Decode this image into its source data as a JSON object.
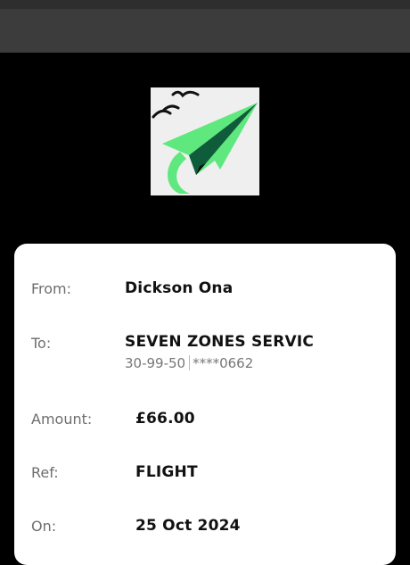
{
  "transfer": {
    "from_label": "From:",
    "from_value": "Dickson Ona",
    "to_label": "To:",
    "to_name": "SEVEN ZONES SERVIC",
    "to_sort_code": "30-99-50",
    "to_account": "****0662",
    "amount_label": "Amount:",
    "amount_value": "£66.00",
    "ref_label": "Ref:",
    "ref_value": "FLIGHT",
    "on_label": "On:",
    "on_value": "25 Oct 2024"
  },
  "colors": {
    "background": "#000000",
    "card": "#ffffff",
    "plane_light": "#5ee87e",
    "plane_dark": "#0f5c3b"
  },
  "logo": {
    "icon": "paper-plane-icon"
  }
}
